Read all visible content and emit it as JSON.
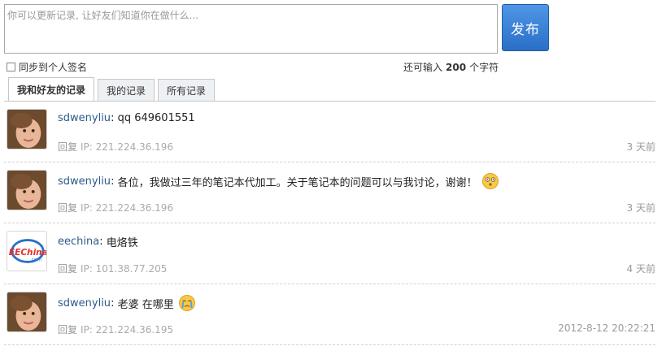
{
  "composer": {
    "placeholder": "你可以更新记录, 让好友们知道你在做什么...",
    "publish_label": "发布",
    "sync_label": "同步到个人签名",
    "counter_prefix": "还可输入",
    "counter_value": "200",
    "counter_suffix": "个字符"
  },
  "tabs": [
    {
      "label": "我和好友的记录",
      "active": true
    },
    {
      "label": "我的记录",
      "active": false
    },
    {
      "label": "所有记录",
      "active": false
    }
  ],
  "feed": [
    {
      "user": "sdwenyliu",
      "text": "qq 649601551",
      "emoji": null,
      "reply": "回复",
      "ip": "IP: 221.224.36.196",
      "time": "3 天前",
      "avatar": "girl-photo"
    },
    {
      "user": "sdwenyliu",
      "text": "各位，我做过三年的笔记本代加工。关于笔记本的问题可以与我讨论，谢谢！",
      "emoji": "shocked-face",
      "reply": "回复",
      "ip": "IP: 221.224.36.196",
      "time": "3 天前",
      "avatar": "girl-photo"
    },
    {
      "user": "eechina",
      "text": "电烙铁",
      "emoji": null,
      "reply": "回复",
      "ip": "IP: 101.38.77.205",
      "time": "4 天前",
      "avatar": "eechina-logo",
      "logo_text": "EEChina",
      "logo_sub": ".com"
    },
    {
      "user": "sdwenyliu",
      "text": "老婆 在哪里",
      "emoji": "crying-face",
      "reply": "回复",
      "ip": "IP: 221.224.36.195",
      "time": "2012-8-12 20:22:21",
      "avatar": "girl-photo"
    }
  ],
  "colors": {
    "accent": "#2a6fc6",
    "username": "#2d5a8a"
  }
}
